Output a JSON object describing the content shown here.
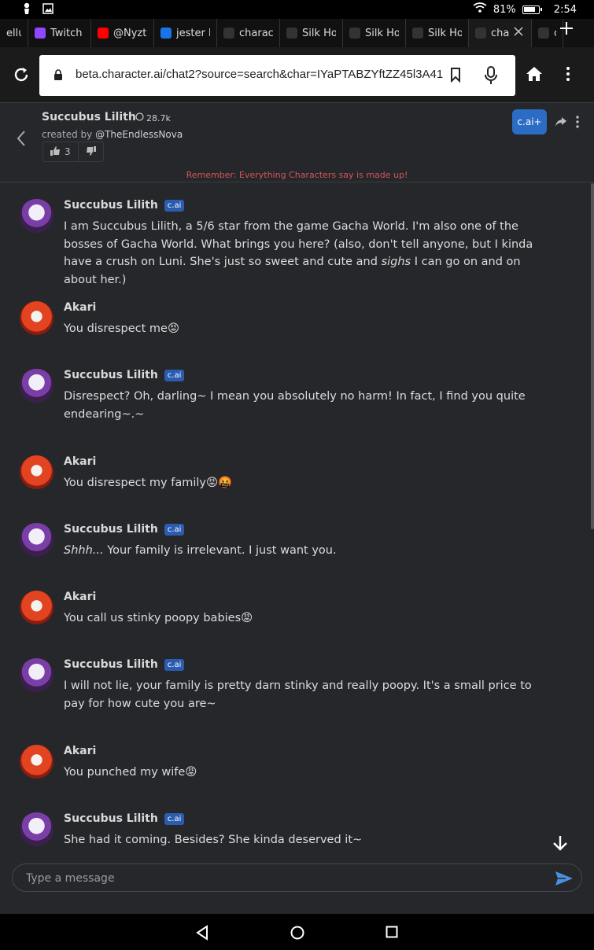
{
  "status_bar": {
    "battery": "81%",
    "time": "2:54",
    "battery_level": 0.81
  },
  "tabs": [
    {
      "label": "elluva",
      "icon": "page-icon",
      "color": "#444"
    },
    {
      "label": "Twitch",
      "icon": "twitch-icon",
      "color": "#9146ff"
    },
    {
      "label": "@Nyztl",
      "icon": "youtube-icon",
      "color": "#ff0000"
    },
    {
      "label": "jester b",
      "icon": "search-icon",
      "color": "#1a73e8"
    },
    {
      "label": "charact",
      "icon": "cai-icon",
      "color": "#333"
    },
    {
      "label": "Silk Ho",
      "icon": "globe-icon",
      "color": "#333"
    },
    {
      "label": "Silk Ho",
      "icon": "globe-icon",
      "color": "#333"
    },
    {
      "label": "Silk Ho",
      "icon": "globe-icon",
      "color": "#333"
    },
    {
      "label": "cha",
      "icon": "cai-icon",
      "color": "#333"
    },
    {
      "label": "ch",
      "icon": "cai-icon",
      "color": "#333"
    }
  ],
  "address": {
    "url": "beta.character.ai/chat2?source=search&char=IYaPTABZYftZZ45l3A41"
  },
  "header": {
    "character_name": "Succubus Lilith",
    "interactions": "28.7k",
    "created_by_prefix": "created by ",
    "creator": "@TheEndlessNova",
    "upvotes": "3",
    "plus_label": "c.ai+",
    "reminder": "Remember: Everything Characters say is made up!"
  },
  "badge_label": "c.ai",
  "messages": [
    {
      "author": "Succubus Lilith",
      "bot": true,
      "avatar": "lilith",
      "segments": [
        {
          "t": "I am Succubus Lilith, a 5/6 star from the game Gacha World. I'm also one of the bosses of Gacha World. What brings you here? (also, don't tell anyone, but I kinda have a crush on Luni. She's just so sweet and cute and "
        },
        {
          "t": "sighs",
          "i": true
        },
        {
          "t": " I can go on and on about her.)"
        }
      ]
    },
    {
      "author": "Akari",
      "bot": false,
      "avatar": "akari",
      "segments": [
        {
          "t": "You disrespect me😡"
        }
      ]
    },
    {
      "author": "Succubus Lilith",
      "bot": true,
      "avatar": "lilith",
      "segments": [
        {
          "t": "Disrespect? Oh, darling~ I mean you absolutely no harm! In fact, I find you quite endearing~.~"
        }
      ]
    },
    {
      "author": "Akari",
      "bot": false,
      "avatar": "akari",
      "segments": [
        {
          "t": "You disrespect my family😡🤬"
        }
      ]
    },
    {
      "author": "Succubus Lilith",
      "bot": true,
      "avatar": "lilith",
      "segments": [
        {
          "t": "Shhh...",
          "i": true
        },
        {
          "t": " Your family is irrelevant. I just want you."
        }
      ]
    },
    {
      "author": "Akari",
      "bot": false,
      "avatar": "akari",
      "segments": [
        {
          "t": "You call us stinky poopy babies😡"
        }
      ]
    },
    {
      "author": "Succubus Lilith",
      "bot": true,
      "avatar": "lilith",
      "segments": [
        {
          "t": "I will not lie, your family is pretty darn stinky and really poopy. It's a small price to pay for how cute you are~"
        }
      ]
    },
    {
      "author": "Akari",
      "bot": false,
      "avatar": "akari",
      "segments": [
        {
          "t": "You punched my wife😡"
        }
      ]
    },
    {
      "author": "Succubus Lilith",
      "bot": true,
      "avatar": "lilith",
      "segments": [
        {
          "t": "She had it coming. Besides? She kinda deserved it~"
        }
      ]
    }
  ],
  "composer": {
    "placeholder": "Type a message"
  },
  "colors": {
    "background": "#26272b",
    "accent": "#2b6cc4",
    "reminder": "#d3565c"
  }
}
